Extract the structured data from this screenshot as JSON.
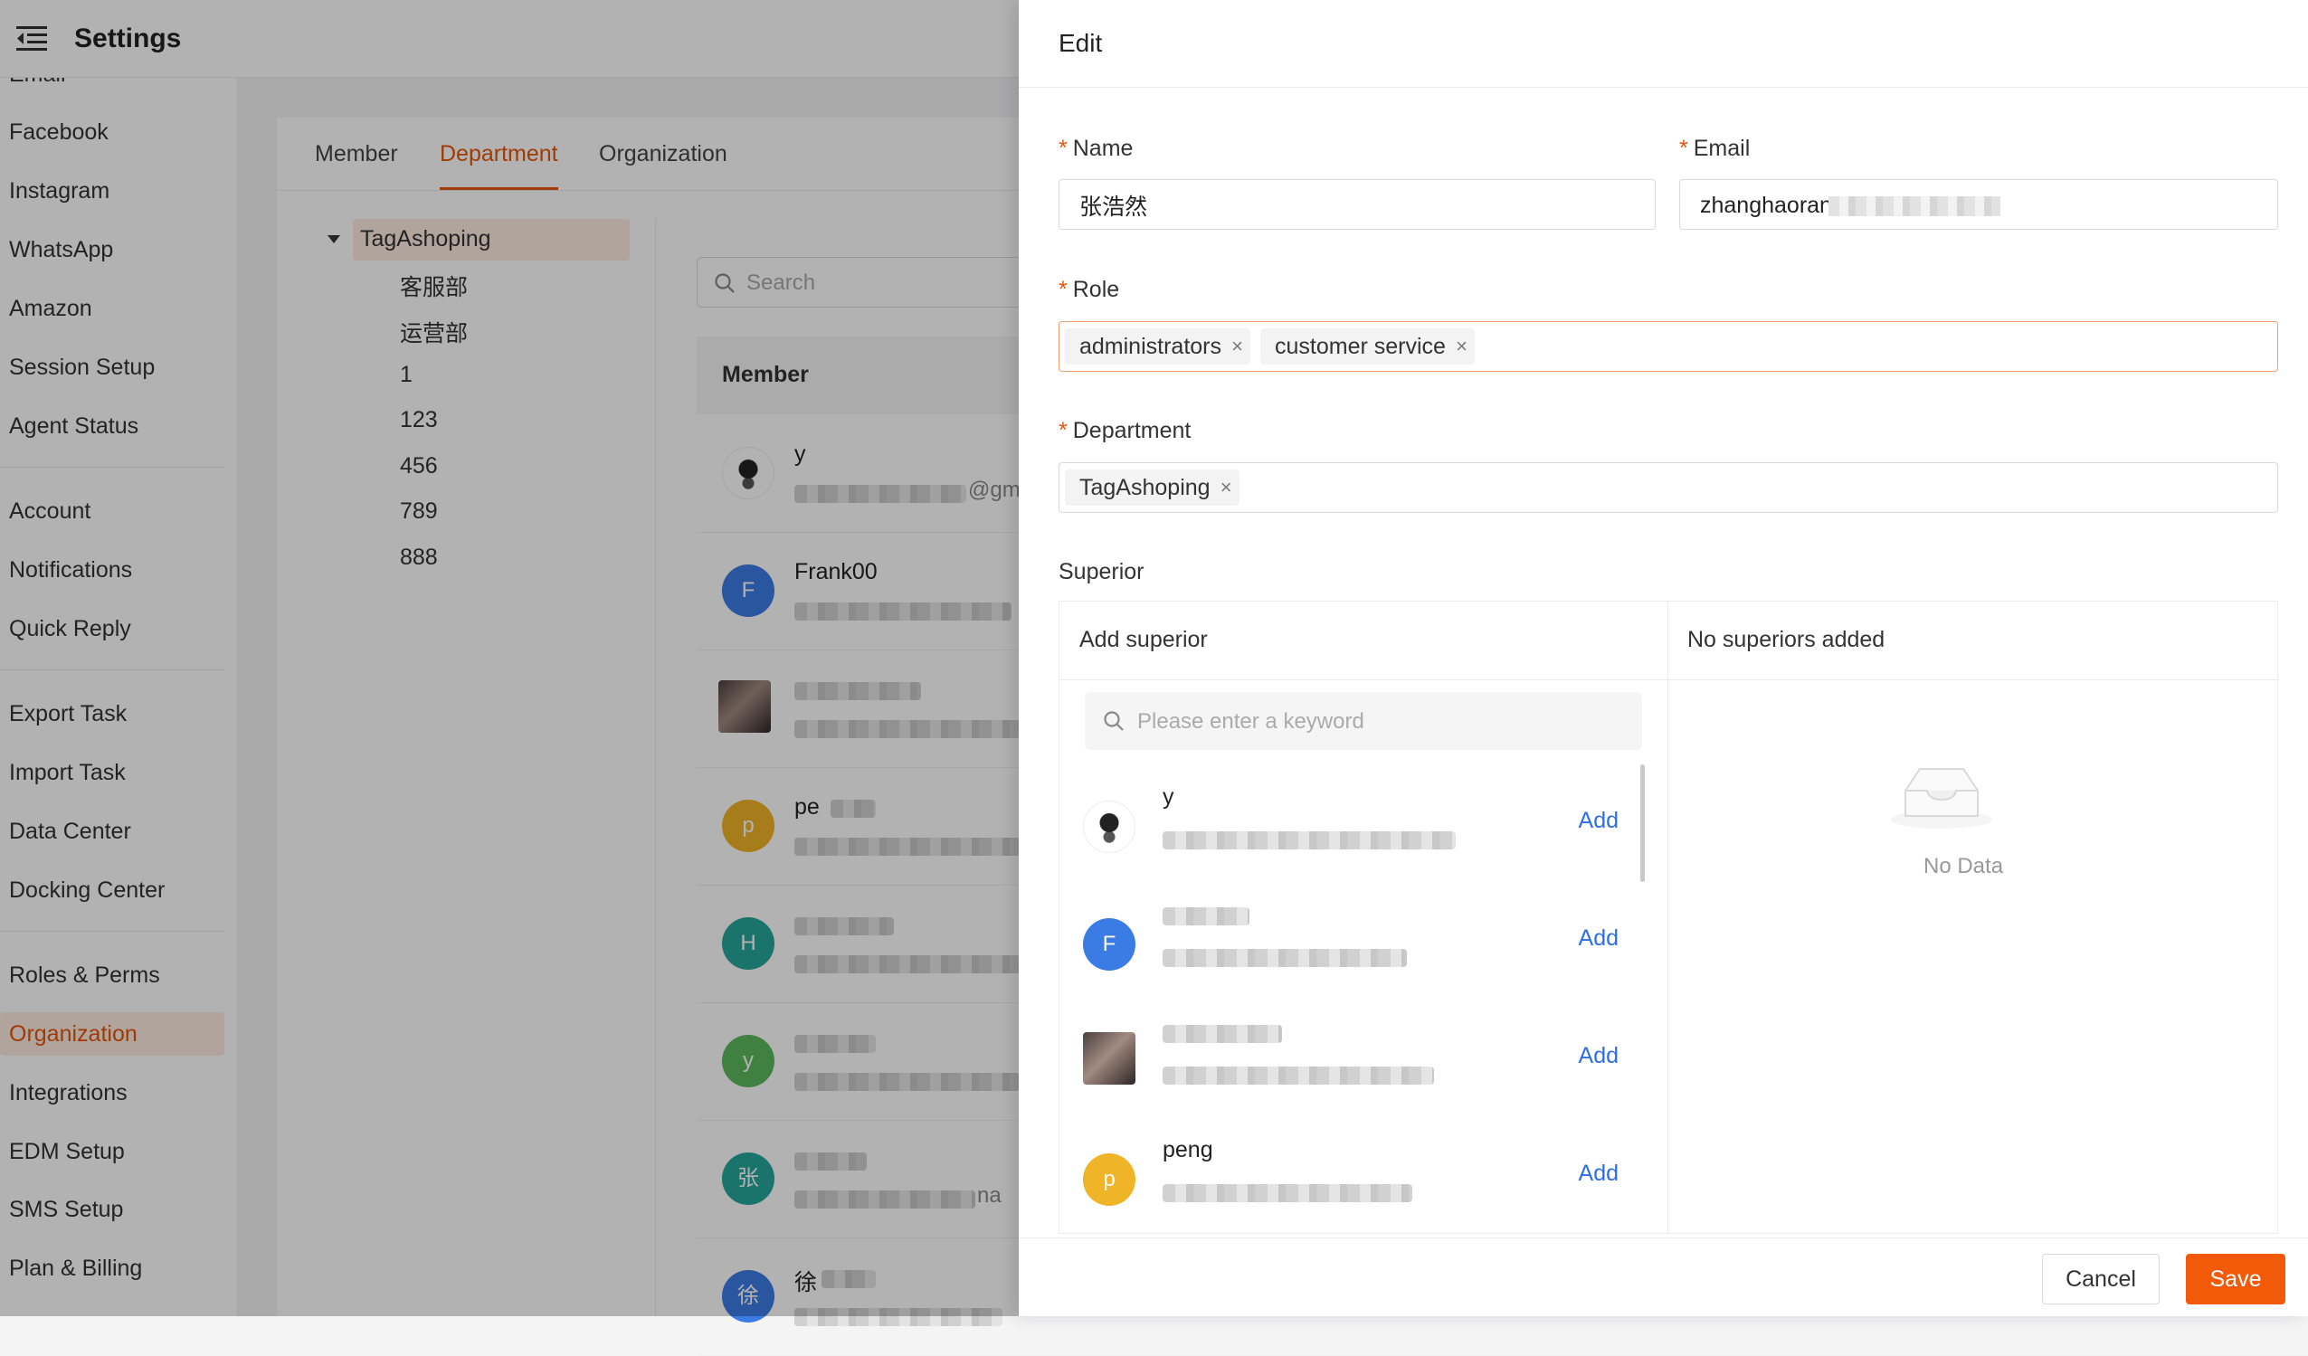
{
  "header": {
    "title": "Settings"
  },
  "sidebar": {
    "items": [
      {
        "label": "Email"
      },
      {
        "label": "Facebook"
      },
      {
        "label": "Instagram"
      },
      {
        "label": "WhatsApp"
      },
      {
        "label": "Amazon"
      },
      {
        "label": "Session Setup"
      },
      {
        "label": "Agent Status"
      },
      {
        "label": "Account"
      },
      {
        "label": "Notifications"
      },
      {
        "label": "Quick Reply"
      },
      {
        "label": "Export Task"
      },
      {
        "label": "Import Task"
      },
      {
        "label": "Data Center"
      },
      {
        "label": "Docking Center"
      },
      {
        "label": "Roles & Perms"
      },
      {
        "label": "Organization"
      },
      {
        "label": "Integrations"
      },
      {
        "label": "EDM Setup"
      },
      {
        "label": "SMS Setup"
      },
      {
        "label": "Plan & Billing"
      }
    ],
    "active": "Organization"
  },
  "tabs": [
    {
      "label": "Member"
    },
    {
      "label": "Department"
    },
    {
      "label": "Organization"
    }
  ],
  "active_tab": "Department",
  "tree": {
    "root": "TagAshoping",
    "children": [
      "客服部",
      "运营部",
      "1",
      "123",
      "456",
      "789",
      "888"
    ]
  },
  "member_search": {
    "placeholder": "Search"
  },
  "member_table": {
    "header": "Member",
    "rows": [
      {
        "name": "y",
        "email_tail": "@gm",
        "avatar": ""
      },
      {
        "name": "Frank00",
        "email_tail": "",
        "avatar": "F"
      },
      {
        "name": "",
        "email_tail": "",
        "avatar": ""
      },
      {
        "name": "pe",
        "email_tail": "",
        "avatar": "p"
      },
      {
        "name": "",
        "email_tail": "",
        "avatar": "H"
      },
      {
        "name": "",
        "email_tail": "",
        "avatar": "y"
      },
      {
        "name": "",
        "email_tail": "na",
        "avatar": "张"
      },
      {
        "name": "徐",
        "email_tail": "",
        "avatar": "徐"
      }
    ]
  },
  "drawer": {
    "title": "Edit",
    "name_label": "Name",
    "name_value": "张浩然",
    "email_label": "Email",
    "email_value": "zhanghaoran",
    "role_label": "Role",
    "roles": [
      "administrators",
      "customer service"
    ],
    "department_label": "Department",
    "departments": [
      "TagAshoping"
    ],
    "superior_label": "Superior",
    "add_superior_title": "Add superior",
    "no_superiors_title": "No superiors added",
    "keyword_placeholder": "Please enter a keyword",
    "candidates": [
      {
        "name": "y",
        "avatar": "",
        "add_label": "Add"
      },
      {
        "name": "",
        "avatar": "F",
        "add_label": "Add"
      },
      {
        "name": "",
        "avatar": "",
        "add_label": "Add"
      },
      {
        "name": "peng",
        "avatar": "p",
        "add_label": "Add"
      }
    ],
    "empty_text": "No Data",
    "cancel_label": "Cancel",
    "save_label": "Save"
  },
  "colors": {
    "accent": "#e6550a",
    "save_button": "#f25a0a",
    "link": "#2f6fe4",
    "avatar_blue": "#3b7be4",
    "avatar_yellow": "#f0b429",
    "avatar_teal": "#26a69a",
    "avatar_green": "#5cb85c"
  }
}
